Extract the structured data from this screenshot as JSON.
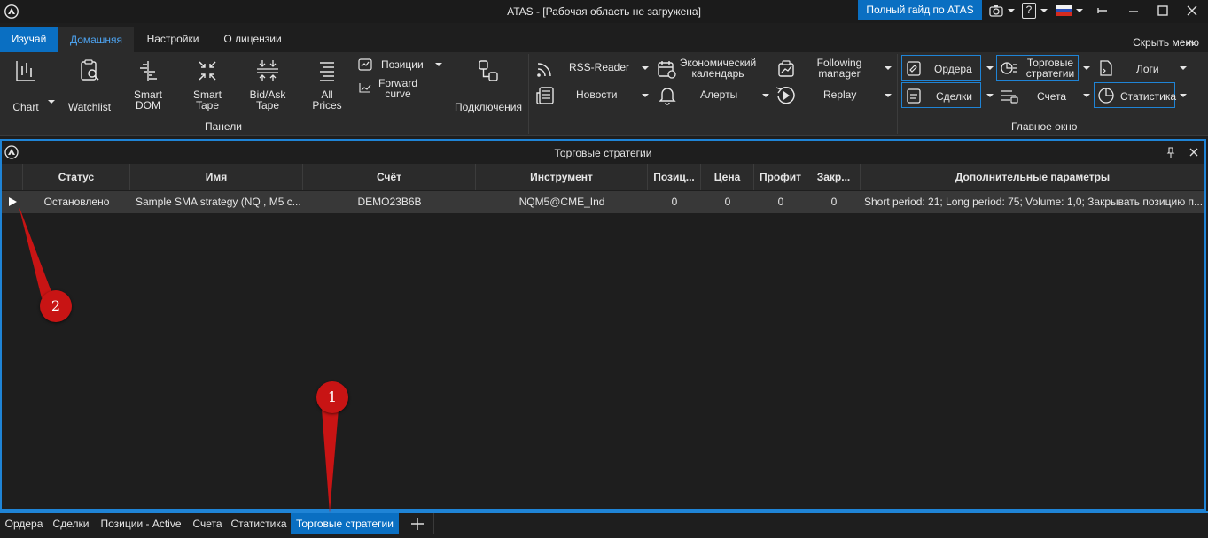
{
  "window": {
    "title": "ATAS - [Рабочая область не загружена]",
    "guide_button": "Полный гайд по ATAS",
    "help_label": "?"
  },
  "ribbon_tabs": {
    "learn": "Изучай",
    "home": "Домашняя",
    "settings": "Настройки",
    "license": "О лицензии",
    "hide_menu": "Скрыть меню"
  },
  "ribbon": {
    "chart": "Chart",
    "watchlist": "Watchlist",
    "smart_dom": [
      "Smart",
      "DOM"
    ],
    "smart_tape": [
      "Smart",
      "Tape"
    ],
    "bidask_tape": [
      "Bid/Ask",
      "Tape"
    ],
    "all_prices": [
      "All",
      "Prices"
    ],
    "positions": "Позиции",
    "forward_curve": [
      "Forward",
      "curve"
    ],
    "panels_group": "Панели",
    "connections": "Подключения",
    "rss": "RSS-Reader",
    "news": "Новости",
    "econ_calendar": [
      "Экономический",
      "календарь"
    ],
    "alerts": "Алерты",
    "following_manager": [
      "Following",
      "manager"
    ],
    "replay": "Replay",
    "orders": "Ордера",
    "deals": "Сделки",
    "strategies": [
      "Торговые",
      "стратегии"
    ],
    "accounts": "Счета",
    "logs": "Логи",
    "statistics": "Статистика",
    "main_window_group": "Главное окно"
  },
  "panel": {
    "title": "Торговые стратегии",
    "columns": [
      "Статус",
      "Имя",
      "Счёт",
      "Инструмент",
      "Позиц...",
      "Цена",
      "Профит",
      "Закр...",
      "Дополнительные параметры"
    ],
    "rows": [
      {
        "status": "Остановлено",
        "name": "Sample SMA strategy (NQ , M5 c...",
        "account": "DEMO23B6B",
        "instrument": "NQM5@CME_Ind",
        "position": "0",
        "price": "0",
        "profit": "0",
        "closed": "0",
        "params": "Short period: 21; Long period: 75; Volume: 1,0; Закрывать позицию п..."
      }
    ]
  },
  "bottom_tabs": [
    "Ордера",
    "Сделки",
    "Позиции - Active",
    "Счета",
    "Статистика",
    "Торговые стратегии"
  ],
  "annotations": {
    "marker_1": "1",
    "marker_2": "2"
  },
  "colors": {
    "accent": "#0a6fc2",
    "border_accent": "#1f84d6",
    "marker": "#c81414",
    "background": "#1e1e1e",
    "ribbon": "#2b2b2b"
  }
}
